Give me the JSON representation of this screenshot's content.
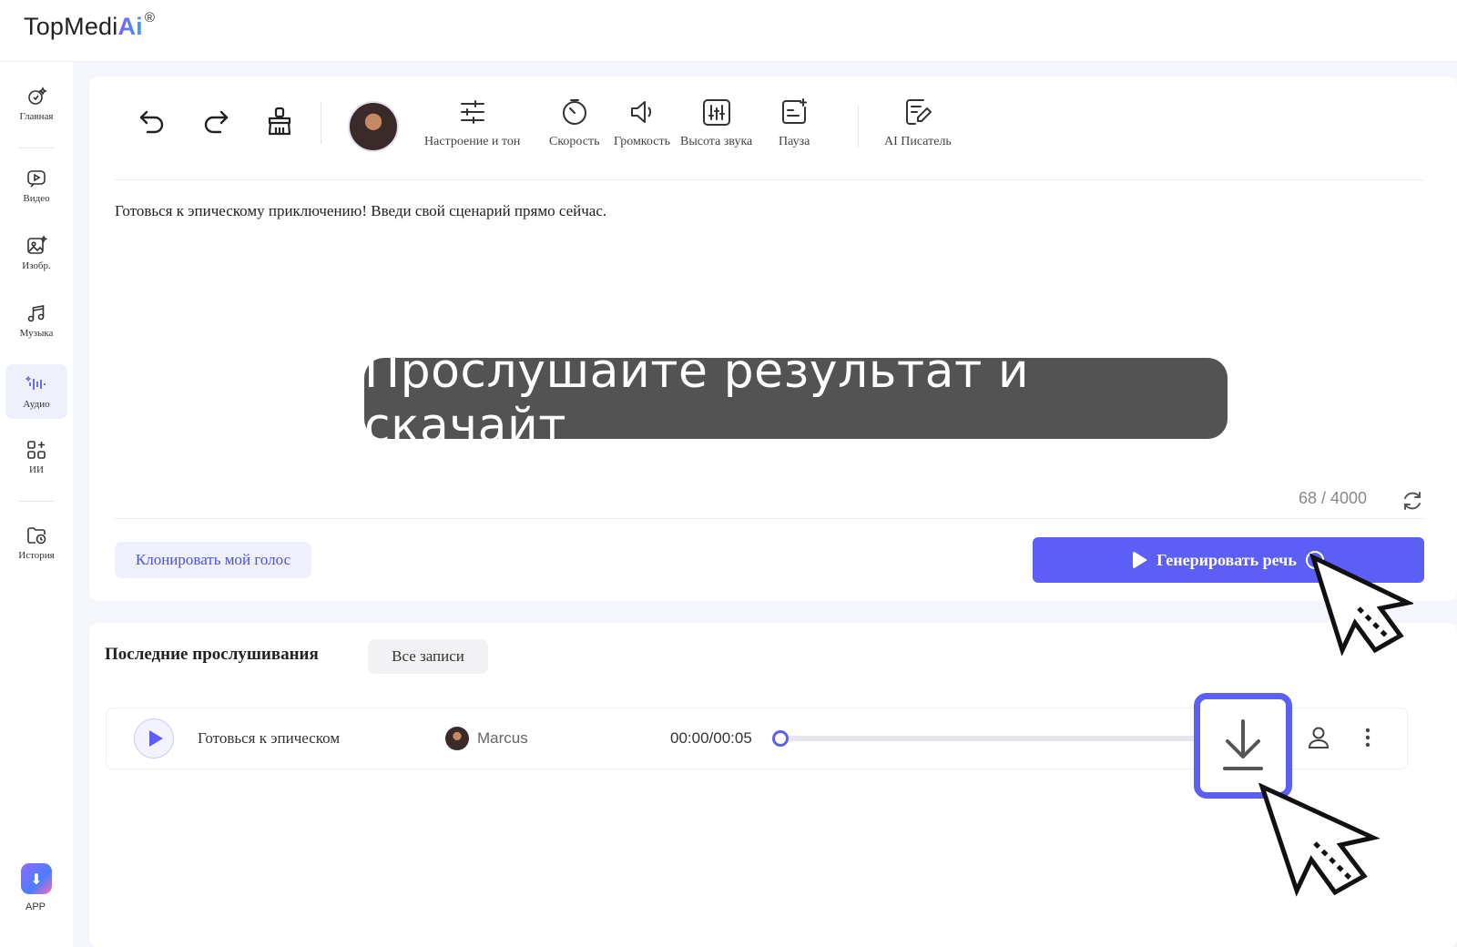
{
  "header": {
    "logo_text": "TopMedi",
    "logo_ai": "Ai",
    "logo_reg": "®"
  },
  "sidebar": {
    "items": [
      {
        "label": "Главная",
        "icon": "home-sparkle-icon"
      },
      {
        "label": "Видео",
        "icon": "video-icon"
      },
      {
        "label": "Изобр.",
        "icon": "image-icon"
      },
      {
        "label": "Музыка",
        "icon": "music-icon"
      },
      {
        "label": "Аудио",
        "icon": "audio-wave-icon",
        "active": true
      },
      {
        "label": "ИИ",
        "icon": "apps-grid-icon"
      },
      {
        "label": "История",
        "icon": "history-folder-icon"
      }
    ],
    "app_label": "APP"
  },
  "toolbar": {
    "undo_icon": "undo-icon",
    "redo_icon": "redo-icon",
    "clear_icon": "broom-icon",
    "mood_label": "Настроение и тон",
    "speed_label": "Скорость",
    "volume_label": "Громкость",
    "pitch_label": "Высота звука",
    "pause_label": "Пауза",
    "writer_label": "AI Писатель"
  },
  "editor": {
    "text": "Готовься к эпическому приключению! Введи свой сценарий прямо сейчас.",
    "counter": "68 / 4000"
  },
  "actions": {
    "clone_label": "Клонировать мой голос",
    "generate_label": "Генерировать речь",
    "info_glyph": "!"
  },
  "caption": "Прослушайте результат и скачайт",
  "history": {
    "title": "Последние прослушивания",
    "all_label": "Все записи",
    "rows": [
      {
        "text": "Готовься к эпическом",
        "voice": "Marcus",
        "time": "00:00/00:05",
        "progress": 0
      }
    ]
  },
  "colors": {
    "accent": "#5b5ff6",
    "caption_bg": "#464646"
  }
}
